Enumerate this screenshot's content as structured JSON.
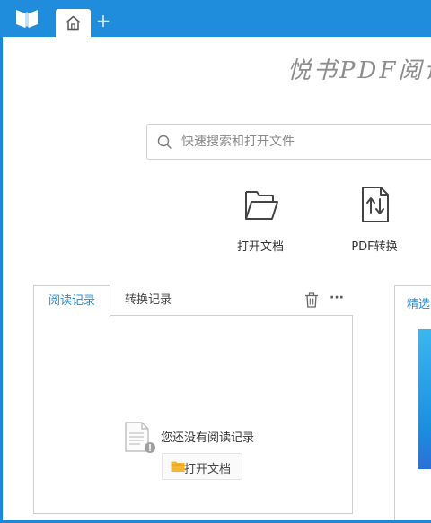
{
  "titlebar": {
    "logo_icon": "book-logo-icon",
    "home_tab_icon": "home-icon",
    "add_tab_label": "+"
  },
  "brand": {
    "text": "悦书PDF阅读"
  },
  "search": {
    "placeholder": "快速搜索和打开文件",
    "value": ""
  },
  "actions": [
    {
      "label": "打开文档",
      "icon": "folder-open-icon"
    },
    {
      "label": "PDF转换",
      "icon": "convert-document-icon"
    }
  ],
  "records_panel": {
    "tabs": [
      {
        "label": "阅读记录",
        "active": true
      },
      {
        "label": "转换记录",
        "active": false
      }
    ],
    "delete_icon": "trash-icon",
    "more_label": "···",
    "empty_text": "您还没有阅读记录",
    "open_button_label": "打开文档"
  },
  "featured_panel": {
    "tab_label": "精选"
  },
  "colors": {
    "accent": "#1f8ddb",
    "window_border": "#1e88d8",
    "folder": "#f5b731"
  }
}
